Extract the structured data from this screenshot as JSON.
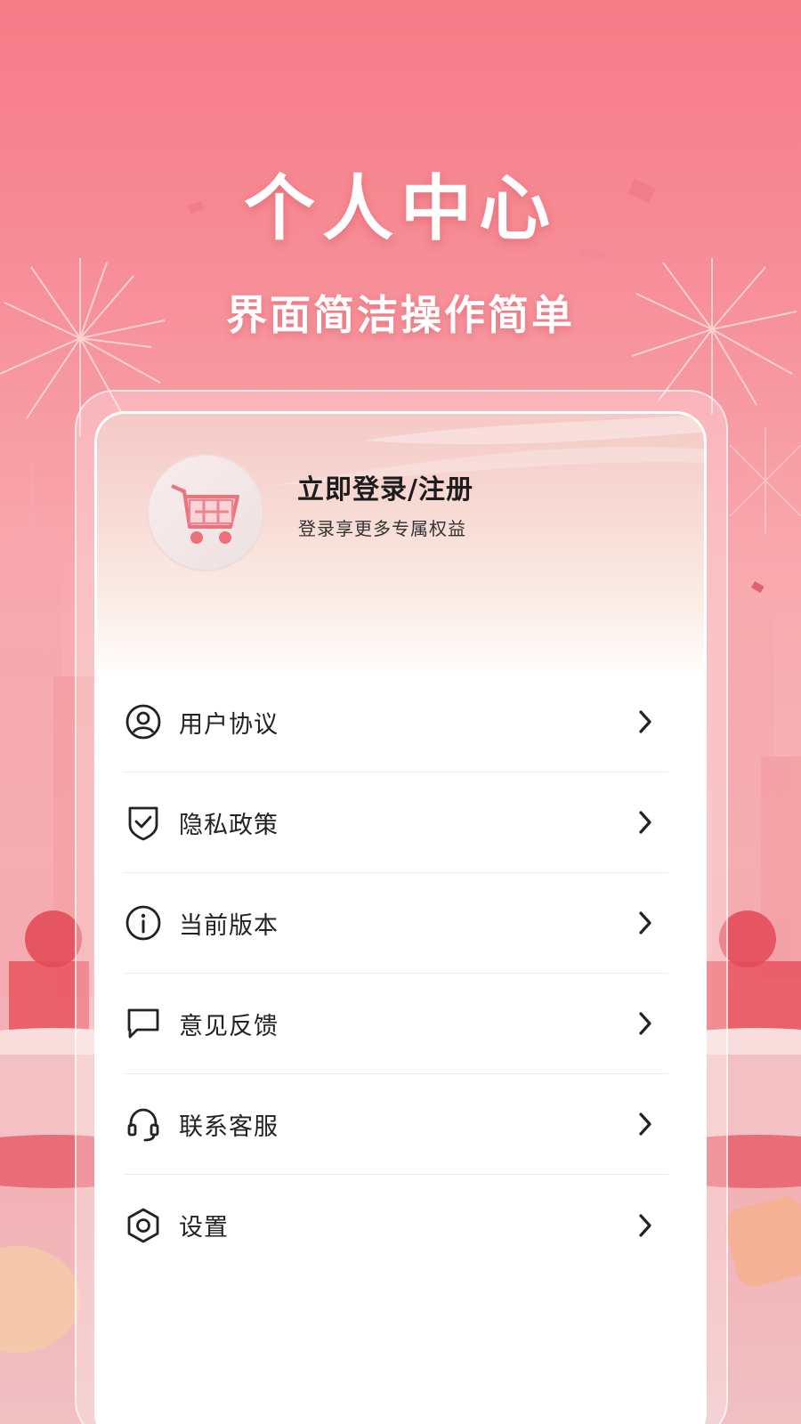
{
  "hero": {
    "title": "个人中心",
    "subtitle": "界面简洁操作简单"
  },
  "profile": {
    "avatar_icon": "shopping-cart-icon",
    "login_title": "立即登录/注册",
    "login_subtitle": "登录享更多专属权益"
  },
  "menu": {
    "items": [
      {
        "label": "用户协议",
        "icon": "user-circle-icon"
      },
      {
        "label": "隐私政策",
        "icon": "shield-check-icon"
      },
      {
        "label": "当前版本",
        "icon": "info-icon"
      },
      {
        "label": "意见反馈",
        "icon": "chat-bubble-icon"
      },
      {
        "label": "联系客服",
        "icon": "headset-icon"
      },
      {
        "label": "设置",
        "icon": "settings-hexagon-icon"
      }
    ]
  },
  "colors": {
    "background_top": "#f57b86",
    "background_bottom": "#f0c0c3",
    "card": "#ffffff",
    "text_primary": "#1d1d1d",
    "icon": "#222222"
  }
}
